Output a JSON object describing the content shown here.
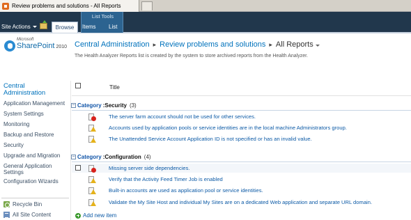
{
  "browser": {
    "tab_title": "Review problems and solutions - All Reports"
  },
  "ribbon": {
    "site_actions": "Site Actions",
    "tabs": {
      "browse": "Browse",
      "items": "Items",
      "list": "List"
    },
    "contextual_group": "List Tools"
  },
  "header": {
    "logo": {
      "microsoft": "Microsoft",
      "product": "SharePoint",
      "version": "2010"
    },
    "breadcrumb": [
      "Central Administration",
      "Review problems and solutions",
      "All Reports"
    ],
    "description": "The Health Analyzer Reports list is created by the system to store archived reports from the Health Analyzer."
  },
  "nav": {
    "heading_line1": "Central",
    "heading_line2": "Administration",
    "items": [
      "Application Management",
      "System Settings",
      "Monitoring",
      "Backup and Restore",
      "Security",
      "Upgrade and Migration",
      "General Application",
      "Settings",
      "Configuration Wizards"
    ],
    "recycle_bin": "Recycle Bin",
    "all_site_content": "All Site Content"
  },
  "list": {
    "column_title": "Title",
    "category_label": "Category",
    "groups": [
      {
        "name": "Security",
        "count": "(3)",
        "rows": [
          {
            "title": "The server farm account should not be used for other services.",
            "severity": "error"
          },
          {
            "title": "Accounts used by application pools or service identities are in the local machine Administrators group.",
            "severity": "warning"
          },
          {
            "title": "The Unattended Service Account Application ID is not specified or has an invalid value.",
            "severity": "warning"
          }
        ]
      },
      {
        "name": "Configuration",
        "count": "(4)",
        "rows": [
          {
            "title": "Missing server side dependencies.",
            "severity": "error"
          },
          {
            "title": "Verify that the Activity Feed Timer Job is enabled",
            "severity": "warning"
          },
          {
            "title": "Built-in accounts are used as application pool or service identities.",
            "severity": "warning"
          },
          {
            "title": "Validate the My Site Host and individual My Sites are on a dedicated Web application and separate URL domain.",
            "severity": "warning"
          }
        ]
      }
    ],
    "add_new_item": "Add new item"
  },
  "colors": {
    "ribbon_bg": "#21374c",
    "list_tools_bg": "#2c6390",
    "link": "#0c5aa6",
    "error": "#d8221c",
    "warning": "#e5b21a"
  },
  "icons": [
    "page-tab-icon",
    "navigate-up-icon",
    "sharepoint-logo-icon",
    "warning-icon",
    "error-icon",
    "recycle-bin-icon",
    "all-site-content-icon",
    "add-icon"
  ]
}
